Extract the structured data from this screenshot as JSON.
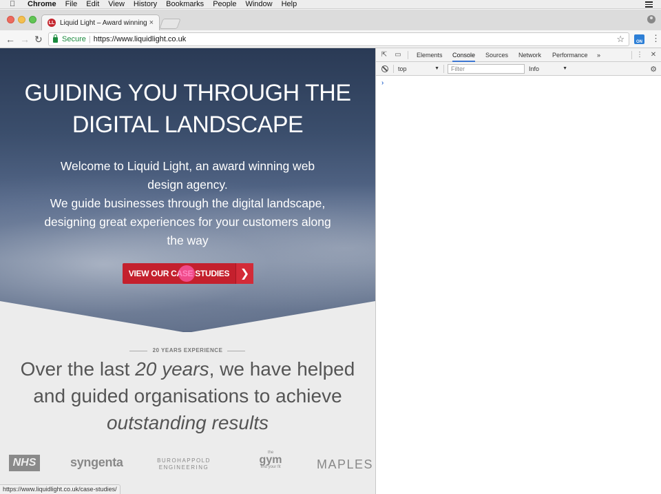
{
  "menubar": {
    "items": [
      "Chrome",
      "File",
      "Edit",
      "View",
      "History",
      "Bookmarks",
      "People",
      "Window",
      "Help"
    ]
  },
  "tab": {
    "title": "Liquid Light – Award winning w",
    "favicon_text": "LL"
  },
  "toolbar": {
    "secure_label": "Secure",
    "url": "https://www.liquidlight.co.uk",
    "ext_label": "ON"
  },
  "hero": {
    "title_line1": "GUIDING YOU THROUGH THE",
    "title_line2": "DIGITAL LANDSCAPE",
    "text_line1": "Welcome to Liquid Light, an award winning web",
    "text_line2": "design agency.",
    "text_line3": "We guide businesses through the digital landscape,",
    "text_line4": "designing great experiences for your customers along",
    "text_line5": "the way",
    "cta_label": "VIEW OUR CASE STUDIES",
    "cta_arrow": "❯"
  },
  "experience": {
    "label": "20 YEARS EXPERIENCE",
    "headline_part1": "Over the last ",
    "headline_em1": "20 years",
    "headline_part2": ", we have helped and guided organisations to achieve ",
    "headline_em2": "outstanding results"
  },
  "clients": {
    "nhs": "NHS",
    "syngenta": "syngenta",
    "buro_line1": "BUROHAPPOLD",
    "buro_line2": "ENGINEERING",
    "gym_top": "the",
    "gym_main": "gym",
    "gym_sub": "find your fit",
    "maples": "MAPLES"
  },
  "statusbar": {
    "url": "https://www.liquidlight.co.uk/case-studies/"
  },
  "devtools": {
    "tabs": [
      "Elements",
      "Console",
      "Sources",
      "Network",
      "Performance"
    ],
    "active_tab": "Console",
    "more": "»",
    "context": "top",
    "filter_placeholder": "Filter",
    "level": "Info",
    "prompt": "›"
  }
}
